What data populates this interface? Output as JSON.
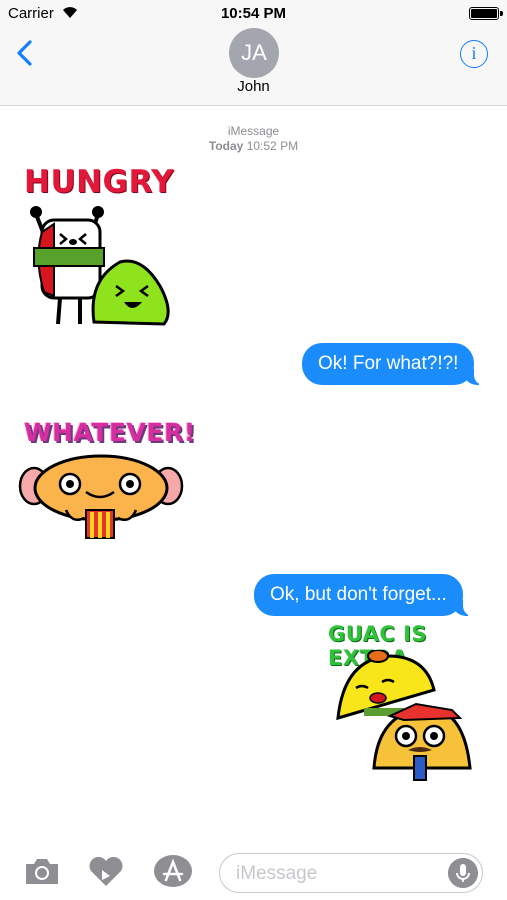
{
  "status_bar": {
    "carrier": "Carrier",
    "time": "10:54 PM",
    "battery_level": 1.0
  },
  "header": {
    "avatar_initials": "JA",
    "contact_name": "John",
    "info_glyph": "i",
    "back_icon": "chevron-left-icon",
    "info_icon": "info-circle-icon"
  },
  "thread": {
    "service": "iMessage",
    "timestamp_day": "Today",
    "timestamp_time": "10:52 PM"
  },
  "messages": [
    {
      "type": "sticker",
      "direction": "incoming",
      "text": "HUNGRY"
    },
    {
      "type": "text",
      "direction": "outgoing",
      "text": "Ok! For what?!?!"
    },
    {
      "type": "sticker",
      "direction": "incoming",
      "text": "WHATEVER!"
    },
    {
      "type": "text",
      "direction": "outgoing",
      "text": "Ok, but don't forget..."
    },
    {
      "type": "sticker",
      "direction": "outgoing",
      "text": "GUAC IS EXTRA"
    }
  ],
  "input_bar": {
    "placeholder": "iMessage",
    "icons": [
      "camera-icon",
      "digital-touch-icon",
      "app-store-icon",
      "microphone-icon"
    ]
  },
  "colors": {
    "accent": "#147efb",
    "outgoing_bubble": "#1a8cfc",
    "timestamp_gray": "#8e8e93",
    "header_bg": "#f7f7f7"
  }
}
